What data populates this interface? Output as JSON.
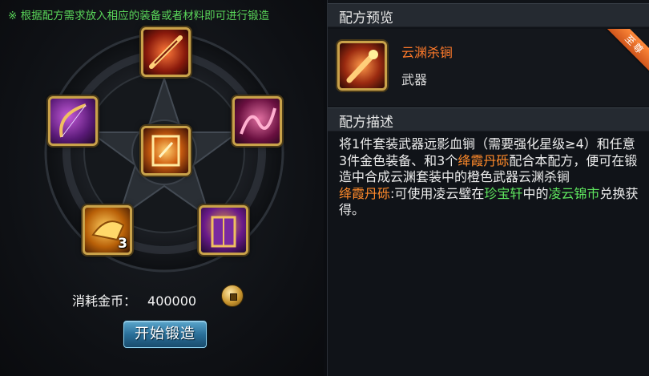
{
  "hint": "※ 根据配方需求放入相应的装备或者材料即可进行锻造",
  "materials": [
    {
      "slot": "top",
      "name": "red-weapon-material"
    },
    {
      "slot": "left",
      "name": "purple-bow-material"
    },
    {
      "slot": "right",
      "name": "purple-whip-material"
    },
    {
      "slot": "center",
      "name": "orange-scroll-material"
    },
    {
      "slot": "bottom-left",
      "name": "gold-crystal-material",
      "qty": "3"
    },
    {
      "slot": "bottom-right",
      "name": "purple-gold-armor-material"
    }
  ],
  "cost": {
    "label": "消耗金币：",
    "value": "400000"
  },
  "forge_button": "开始锻造",
  "preview": {
    "title": "配方预览",
    "item_name": "云渊杀锏",
    "item_type": "武器",
    "ribbon": "至尊"
  },
  "description": {
    "title": "配方描述",
    "p1_a": "将1件套装武器远影血锏（需要强化星级≥4）和任意3件金色装备、和3个",
    "p1_hl": "绛霞丹砾",
    "p1_b": "配合本配方，便可在锻造中合成云渊套装中的橙色武器云渊杀锏",
    "p2_hl1": "绛霞丹砾",
    "p2_a": ":可使用凌云璧在",
    "p2_hl2": "珍宝轩",
    "p2_b": "中的",
    "p2_hl3": "凌云锦市",
    "p2_c": "兑换获得。"
  },
  "colors": {
    "hint": "#5ad65a",
    "item_name": "#ff7a2a",
    "highlight_orange": "#ff8a2a",
    "highlight_green": "#5ee65e",
    "button": "#2a6f99"
  }
}
